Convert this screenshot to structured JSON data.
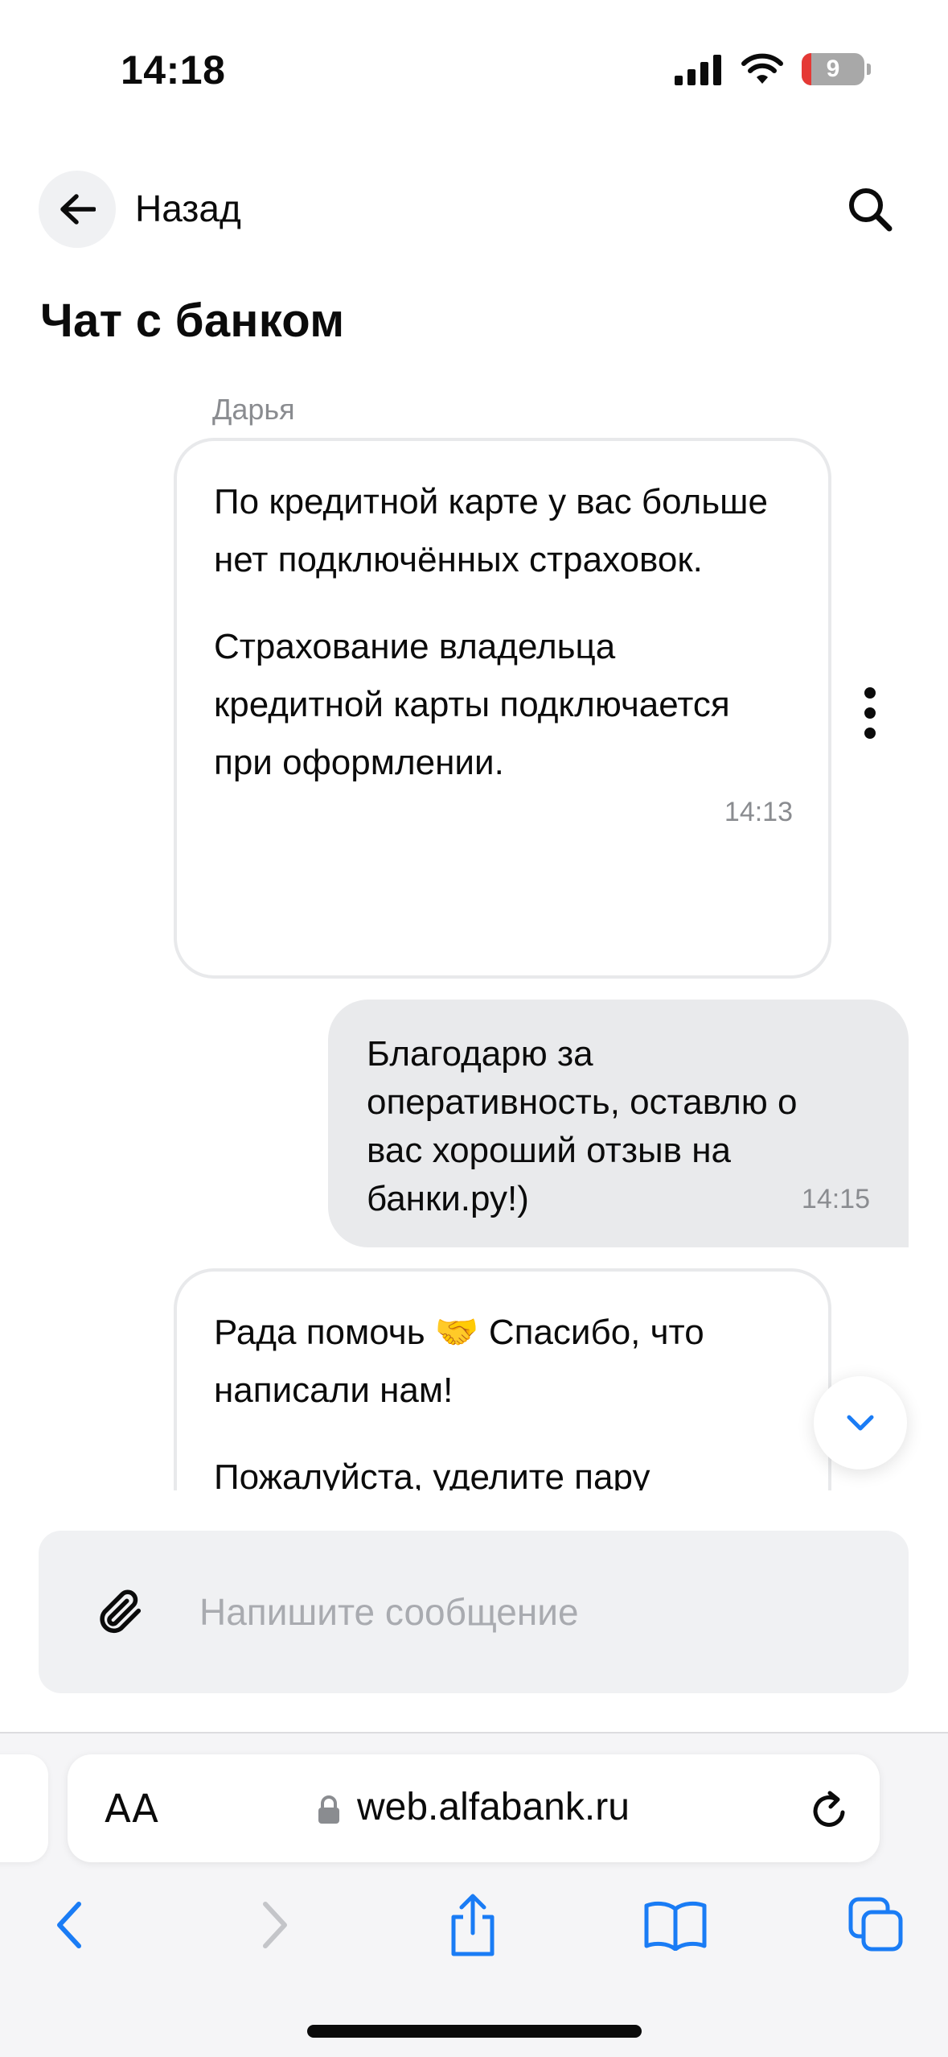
{
  "status_bar": {
    "time": "14:18",
    "battery": "9"
  },
  "header": {
    "back_label": "Назад",
    "title": "Чат с банком"
  },
  "chat": {
    "messages": [
      {
        "direction": "incoming",
        "sender": "Дарья",
        "paragraphs": [
          "По кредитной карте у вас больше нет подключённых страховок.",
          "Страхование владельца кредитной карты подключается при оформлении."
        ],
        "time": "14:13"
      },
      {
        "direction": "outgoing",
        "text": "Благодарю за оперативность, оставлю о вас хороший отзыв на банки.ру!)",
        "time": "14:15"
      },
      {
        "direction": "incoming",
        "paragraphs": [
          "Рада помочь 🤝 Спасибо, что написали нам!",
          "Пожалуйста, уделите пару"
        ]
      }
    ]
  },
  "composer": {
    "placeholder": "Напишите сообщение"
  },
  "browser": {
    "text_size_label": "AA",
    "url": "web.alfabank.ru"
  },
  "colors": {
    "accent_blue": "#1a7cf5",
    "outgoing_bubble": "#e9eaec",
    "incoming_border": "#e8e9eb",
    "muted_text": "#8a8c90"
  },
  "icons": [
    "cellular-signal-icon",
    "wifi-icon",
    "battery-icon",
    "back-arrow-icon",
    "search-icon",
    "more-vertical-icon",
    "chevron-down-icon",
    "paperclip-icon",
    "lock-icon",
    "reload-icon",
    "nav-back-icon",
    "nav-forward-icon",
    "share-icon",
    "bookmarks-icon",
    "tabs-icon"
  ]
}
